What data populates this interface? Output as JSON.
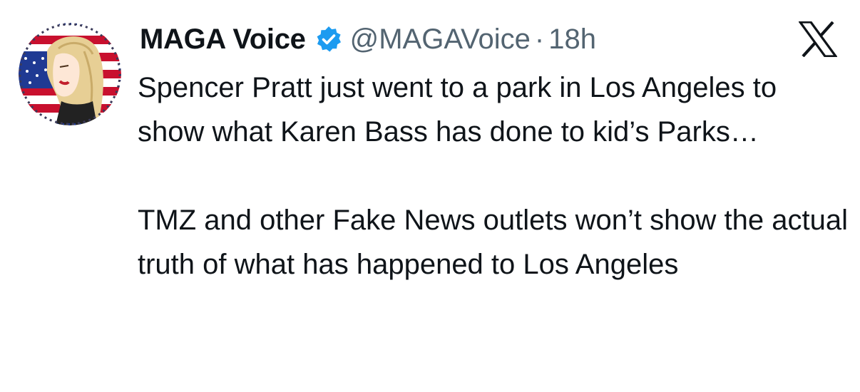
{
  "tweet": {
    "author": {
      "display_name": "MAGA Voice",
      "handle": "@MAGAVoice",
      "verified": true,
      "avatar_icon": "profile-avatar"
    },
    "separator": "·",
    "time": "18h",
    "platform_icon": "x-logo-icon",
    "text": {
      "paragraph_1": "Spencer Pratt just went to a park in Los Angeles to show what Karen Bass has done to kid’s Parks…",
      "paragraph_2": "TMZ and other Fake News outlets won’t show the actual truth of what has happened to Los Angeles"
    }
  },
  "colors": {
    "text_primary": "#0f1419",
    "text_secondary": "#536471",
    "verified_blue": "#1d9bf0"
  }
}
